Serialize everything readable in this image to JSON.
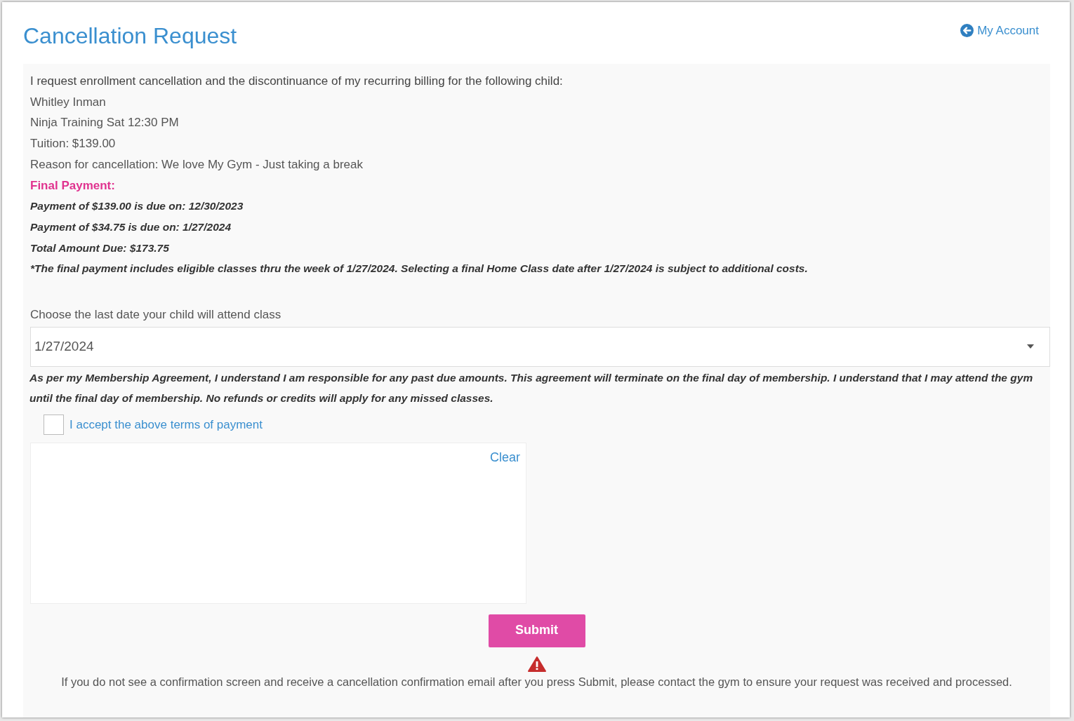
{
  "title": "Cancellation Request",
  "account_link": "My Account",
  "intro": "I request enrollment cancellation and the discontinuance of my recurring billing for the following child:",
  "details": [
    "Whitley Inman",
    "Ninja Training Sat 12:30 PM",
    "Tuition: $139.00",
    "Reason for cancellation: We love My Gym - Just taking a break"
  ],
  "final_payment": {
    "heading": "Final Payment:",
    "lines": [
      "Payment of $139.00 is due on: 12/30/2023",
      "Payment of $34.75 is due on: 1/27/2024",
      "Total Amount Due: $173.75",
      "*The final payment includes eligible classes thru the week of 1/27/2024. Selecting a final Home Class date after 1/27/2024 is subject to additional costs."
    ]
  },
  "last_date": {
    "label": "Choose the last date your child will attend class",
    "value": "1/27/2024"
  },
  "agreement": "As per my Membership Agreement, I understand I am responsible for any past due amounts. This agreement will terminate on the final day of membership. I understand that I may attend the gym until the final day of membership. No refunds or credits will apply for any missed classes.",
  "accept": {
    "label": "I accept the above terms of payment",
    "checked": false
  },
  "signature": {
    "clear": "Clear"
  },
  "submit": "Submit",
  "warning": "If you do not see a confirmation screen and receive a cancellation confirmation email after you press Submit, please contact the gym to ensure your request was received and processed."
}
